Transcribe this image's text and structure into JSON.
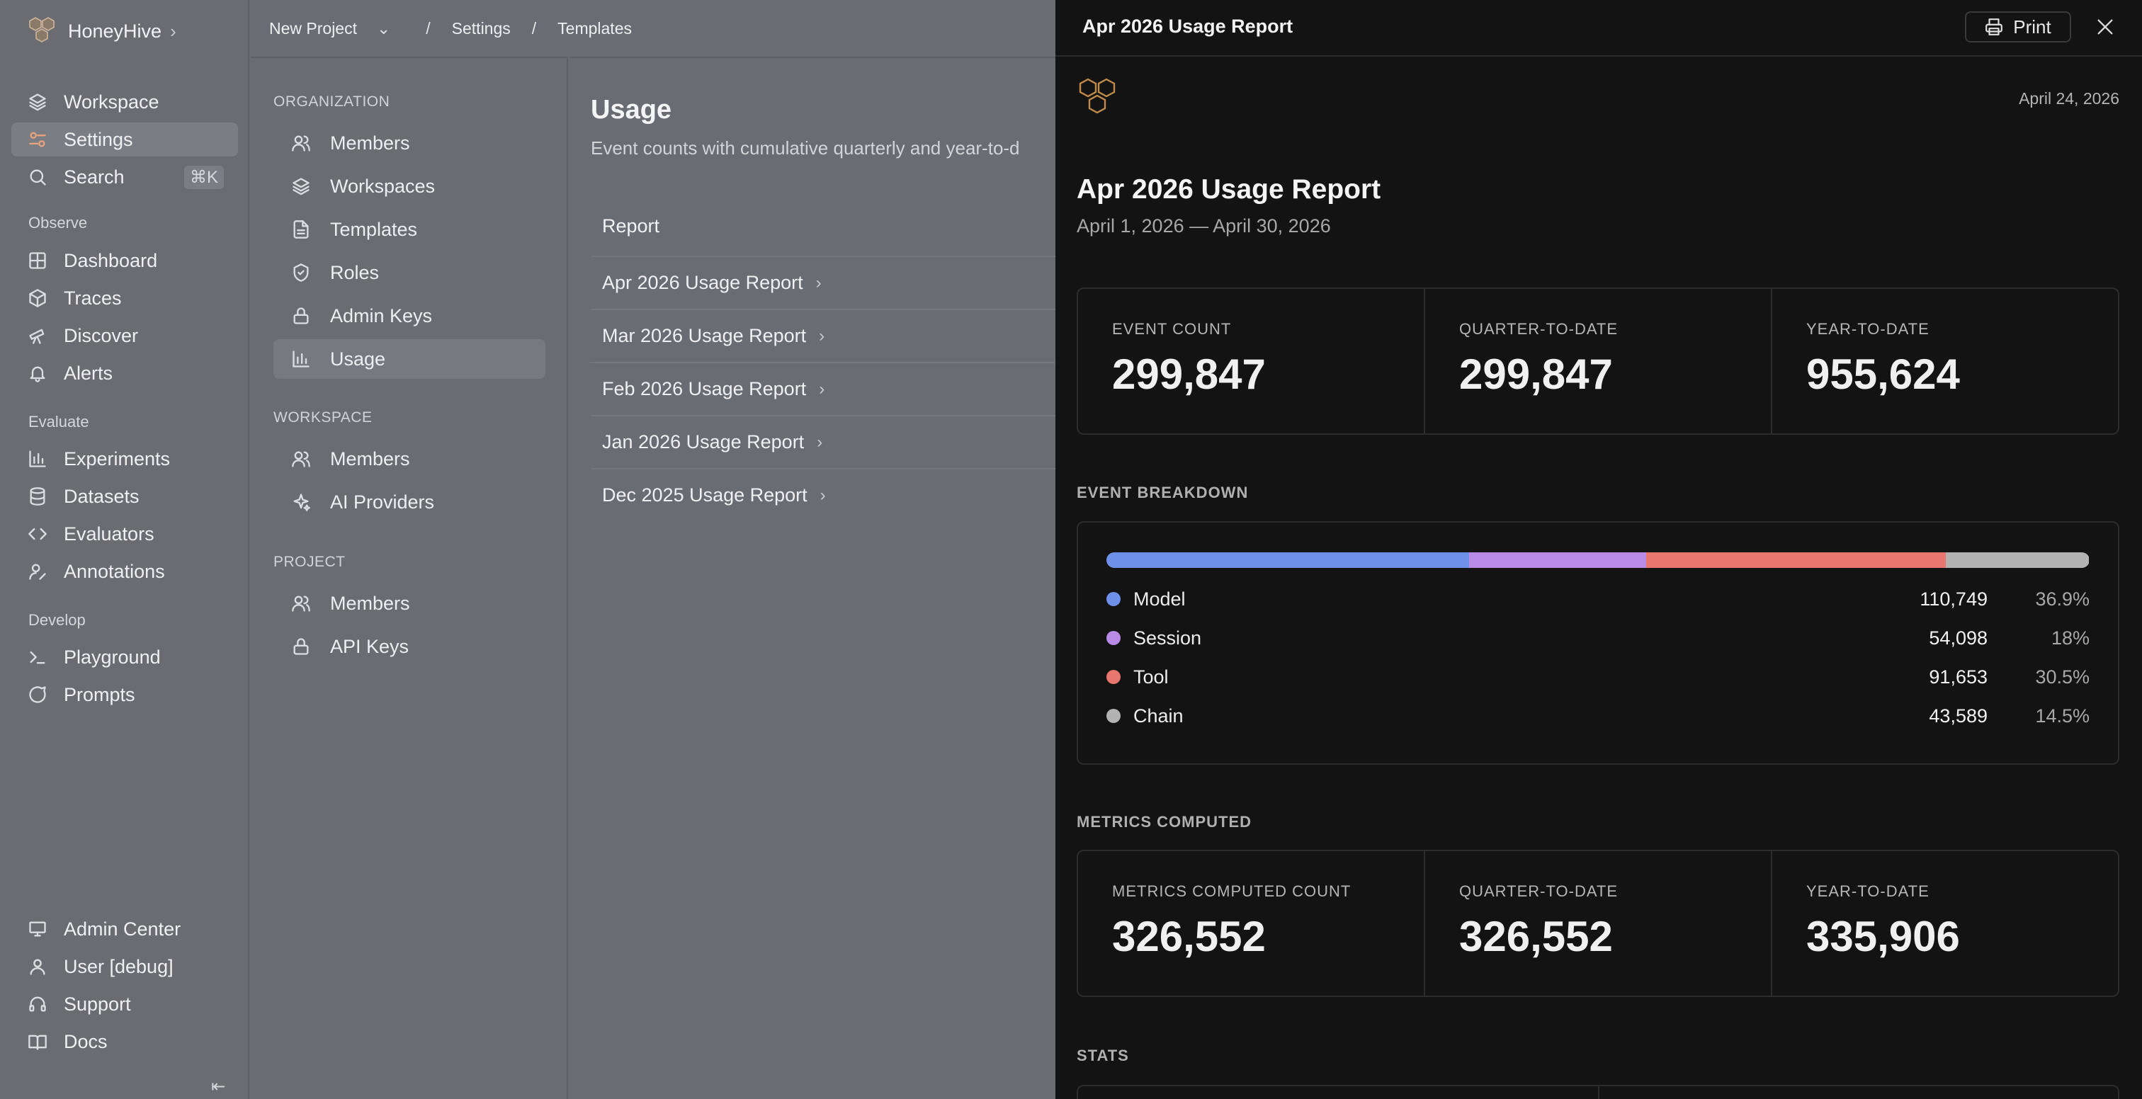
{
  "sidebar": {
    "brand": "HoneyHive",
    "top": [
      {
        "label": "Workspace",
        "icon": "layers-icon"
      },
      {
        "label": "Settings",
        "icon": "settings-sliders-icon",
        "active": true
      },
      {
        "label": "Search",
        "icon": "search-icon",
        "shortcut": "⌘K"
      }
    ],
    "sections": [
      {
        "title": "Observe",
        "items": [
          {
            "label": "Dashboard",
            "icon": "grid-icon"
          },
          {
            "label": "Traces",
            "icon": "cube-icon"
          },
          {
            "label": "Discover",
            "icon": "telescope-icon"
          },
          {
            "label": "Alerts",
            "icon": "bell-icon"
          }
        ]
      },
      {
        "title": "Evaluate",
        "items": [
          {
            "label": "Experiments",
            "icon": "bar-chart-icon"
          },
          {
            "label": "Datasets",
            "icon": "database-icon"
          },
          {
            "label": "Evaluators",
            "icon": "code-icon"
          },
          {
            "label": "Annotations",
            "icon": "user-pen-icon"
          }
        ]
      },
      {
        "title": "Develop",
        "items": [
          {
            "label": "Playground",
            "icon": "terminal-icon"
          },
          {
            "label": "Prompts",
            "icon": "chat-bubble-icon"
          }
        ]
      }
    ],
    "bottom": [
      {
        "label": "Admin Center",
        "icon": "monitor-icon"
      },
      {
        "label": "User [debug]",
        "icon": "user-icon"
      },
      {
        "label": "Support",
        "icon": "headset-icon"
      },
      {
        "label": "Docs",
        "icon": "book-icon"
      }
    ],
    "collapse_glyph": "⇤"
  },
  "breadcrumb": {
    "project": "New Project",
    "settings": "Settings",
    "templates": "Templates",
    "separator": "/"
  },
  "subnav": {
    "organization": {
      "title": "ORGANIZATION",
      "items": [
        {
          "label": "Members",
          "icon": "users-icon"
        },
        {
          "label": "Workspaces",
          "icon": "layers-icon"
        },
        {
          "label": "Templates",
          "icon": "file-icon"
        },
        {
          "label": "Roles",
          "icon": "shield-icon"
        },
        {
          "label": "Admin Keys",
          "icon": "lock-icon"
        },
        {
          "label": "Usage",
          "icon": "bar-chart-icon",
          "active": true
        }
      ]
    },
    "workspace": {
      "title": "WORKSPACE",
      "items": [
        {
          "label": "Members",
          "icon": "users-icon"
        },
        {
          "label": "AI Providers",
          "icon": "sparkles-icon"
        }
      ]
    },
    "project": {
      "title": "PROJECT",
      "items": [
        {
          "label": "Members",
          "icon": "users-icon"
        },
        {
          "label": "API Keys",
          "icon": "lock-icon"
        }
      ]
    }
  },
  "usage": {
    "title": "Usage",
    "description": "Event counts with cumulative quarterly and year-to-d",
    "column_header": "Report",
    "reports": [
      "Apr 2026 Usage Report",
      "Mar 2026 Usage Report",
      "Feb 2026 Usage Report",
      "Jan 2026 Usage Report",
      "Dec 2025 Usage Report"
    ]
  },
  "panel": {
    "header_title": "Apr 2026 Usage Report",
    "print_label": "Print",
    "date": "April 24, 2026",
    "title": "Apr 2026 Usage Report",
    "range": "April 1, 2026 — April 30, 2026",
    "event_stats": [
      {
        "label": "EVENT COUNT",
        "value": "299,847"
      },
      {
        "label": "QUARTER-TO-DATE",
        "value": "299,847"
      },
      {
        "label": "YEAR-TO-DATE",
        "value": "955,624"
      }
    ],
    "breakdown_title": "EVENT BREAKDOWN",
    "breakdown": [
      {
        "name": "Model",
        "count": "110,749",
        "pct": "36.9%",
        "fraction": 0.369,
        "color": "#6f90e8"
      },
      {
        "name": "Session",
        "count": "54,098",
        "pct": "18%",
        "fraction": 0.18,
        "color": "#b98ae6"
      },
      {
        "name": "Tool",
        "count": "91,653",
        "pct": "30.5%",
        "fraction": 0.305,
        "color": "#e8776f"
      },
      {
        "name": "Chain",
        "count": "43,589",
        "pct": "14.5%",
        "fraction": 0.145,
        "color": "#b3b3b3"
      }
    ],
    "metrics_title": "METRICS COMPUTED",
    "metric_stats": [
      {
        "label": "METRICS COMPUTED COUNT",
        "value": "326,552"
      },
      {
        "label": "QUARTER-TO-DATE",
        "value": "326,552"
      },
      {
        "label": "YEAR-TO-DATE",
        "value": "335,906"
      }
    ],
    "stats_title": "STATS"
  }
}
